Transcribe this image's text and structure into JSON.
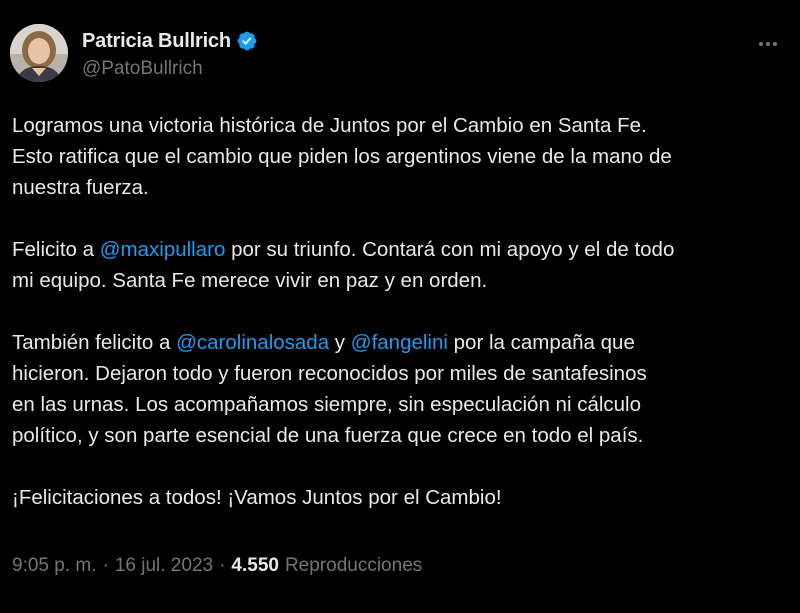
{
  "author": {
    "display_name": "Patricia Bullrich",
    "handle": "@PatoBullrich",
    "verified_icon": "verified-badge-icon",
    "verified_color": "#1d9bf0"
  },
  "more_icon": "more-options-icon",
  "tweet": {
    "p1_line1": "Logramos una victoria histórica de Juntos por el Cambio en Santa Fe.",
    "p1_line2": "Esto ratifica que el cambio que piden los argentinos viene de la mano de",
    "p1_line3": "nuestra fuerza.",
    "p2_pre": "Felicito a ",
    "p2_mention": "@maxipullaro",
    "p2_post": " por su triunfo. Contará con mi apoyo y el de todo",
    "p2_line2": "mi equipo. Santa Fe merece vivir en paz y en orden.",
    "p3_pre": "También felicito a ",
    "p3_mention1": "@carolinalosada",
    "p3_mid": " y ",
    "p3_mention2": "@fangelini",
    "p3_post": " por la campaña que",
    "p3_line2": "hicieron. Dejaron todo y fueron reconocidos por miles de santafesinos",
    "p3_line3": "en las urnas. Los acompañamos siempre, sin especulación ni cálculo",
    "p3_line4": "político, y son parte esencial de una fuerza que crece en todo el país.",
    "p4": "¡Felicitaciones a todos! ¡Vamos Juntos por el Cambio!"
  },
  "meta": {
    "time": "9:05 p. m.",
    "separator": "·",
    "date": "16 jul. 2023",
    "views_count": "4.550",
    "views_label": "Reproducciones"
  },
  "colors": {
    "background": "#000000",
    "text": "#e7e9ea",
    "secondary": "#71767b",
    "link": "#1d9bf0"
  }
}
